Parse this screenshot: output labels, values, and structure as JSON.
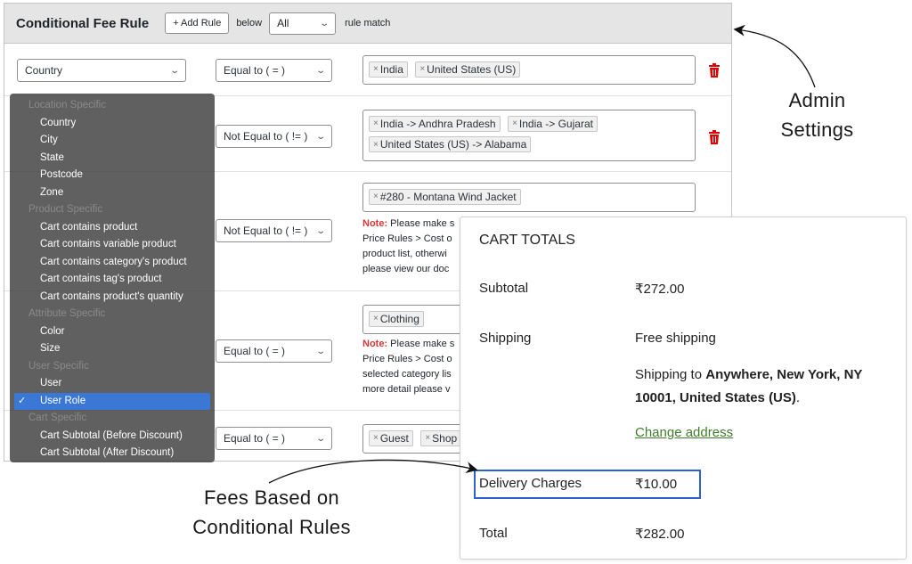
{
  "admin": {
    "title": "Conditional Fee Rule",
    "add_rule_label": "+ Add Rule",
    "below_text": "below",
    "match_value": "All",
    "rule_match_text": "rule match"
  },
  "rules": [
    {
      "condition": "Country",
      "operator": "Equal to ( = )",
      "tags": [
        "India",
        "United States (US)"
      ]
    },
    {
      "condition": "",
      "operator": "Not Equal to ( != )",
      "tags": [
        "India -> Andhra Pradesh",
        "India -> Gujarat",
        "United States (US) -> Alabama"
      ]
    },
    {
      "condition": "",
      "operator": "Not Equal to ( != )",
      "tags": [
        "#280 - Montana Wind Jacket"
      ],
      "note_label": "Note:",
      "note_lines": [
        "Please make s",
        "Price Rules > Cost o",
        "product list, otherwi",
        "please view our doc"
      ]
    },
    {
      "condition": "",
      "operator": "Equal to ( = )",
      "tags": [
        "Clothing"
      ],
      "note_label": "Note:",
      "note_lines": [
        "Please make s",
        "Price Rules > Cost o",
        "selected category lis",
        "more detail please v"
      ]
    },
    {
      "condition": "",
      "operator": "Equal to ( = )",
      "tags": [
        "Guest",
        "Shop"
      ]
    }
  ],
  "dropdown": {
    "entries": [
      {
        "type": "group",
        "label": "Location Specific"
      },
      {
        "type": "item",
        "label": "Country"
      },
      {
        "type": "item",
        "label": "City"
      },
      {
        "type": "item",
        "label": "State"
      },
      {
        "type": "item",
        "label": "Postcode"
      },
      {
        "type": "item",
        "label": "Zone"
      },
      {
        "type": "group",
        "label": "Product Specific"
      },
      {
        "type": "item",
        "label": "Cart contains product"
      },
      {
        "type": "item",
        "label": "Cart contains variable product"
      },
      {
        "type": "item",
        "label": "Cart contains category's product"
      },
      {
        "type": "item",
        "label": "Cart contains tag's product"
      },
      {
        "type": "item",
        "label": "Cart contains product's quantity"
      },
      {
        "type": "group",
        "label": "Attribute Specific"
      },
      {
        "type": "item",
        "label": "Color"
      },
      {
        "type": "item",
        "label": "Size"
      },
      {
        "type": "group",
        "label": "User Specific"
      },
      {
        "type": "item",
        "label": "User"
      },
      {
        "type": "item",
        "label": "User Role",
        "selected": true
      },
      {
        "type": "group",
        "label": "Cart Specific"
      },
      {
        "type": "item",
        "label": "Cart Subtotal (Before Discount)"
      },
      {
        "type": "item",
        "label": "Cart Subtotal (After Discount)"
      }
    ],
    "check_glyph": "✓"
  },
  "cart": {
    "title": "CART TOTALS",
    "subtotal_label": "Subtotal",
    "subtotal_value": "₹272.00",
    "shipping_label": "Shipping",
    "shipping_value": "Free shipping",
    "shipping_to_prefix": "Shipping to ",
    "shipping_address": "Anywhere, New York, NY 10001, United States (US)",
    "shipping_to_suffix": ".",
    "change_address": "Change address",
    "fee_label": "Delivery Charges",
    "fee_value": "₹10.00",
    "total_label": "Total",
    "total_value": "₹282.00"
  },
  "annotations": {
    "admin_line1": "Admin",
    "admin_line2": "Settings",
    "fees_line1": "Fees Based on",
    "fees_line2": "Conditional Rules"
  },
  "colors": {
    "trash": "#e00000",
    "highlight_border": "#2d60d4",
    "selected_item": "#3b78d6",
    "link": "#417b2e"
  },
  "icons": [
    "chevron-down-icon",
    "trash-icon",
    "remove-x-icon",
    "check-icon",
    "arrow-icon"
  ]
}
